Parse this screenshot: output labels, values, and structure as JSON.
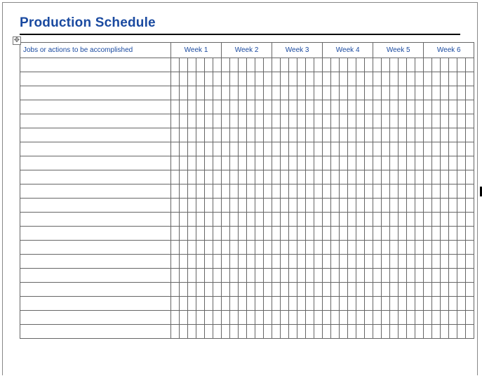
{
  "title": "Production Schedule",
  "table": {
    "jobs_header": "Jobs or actions to be accomplished",
    "weeks": [
      "Week 1",
      "Week 2",
      "Week 3",
      "Week 4",
      "Week 5",
      "Week 6"
    ],
    "subcols_per_week": 6,
    "row_count": 20
  }
}
